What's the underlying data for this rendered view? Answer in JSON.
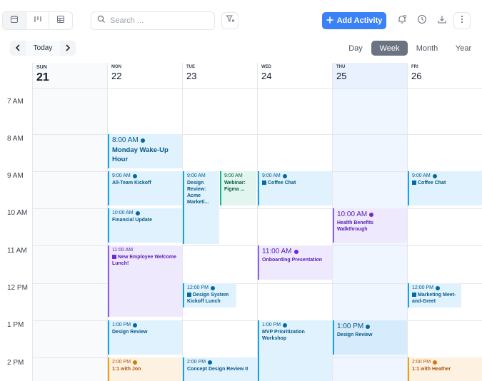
{
  "toolbar": {
    "search_placeholder": "Search ...",
    "add_activity_label": "Add Activity",
    "today_label": "Today"
  },
  "views": [
    {
      "label": "Day",
      "active": false
    },
    {
      "label": "Week",
      "active": true
    },
    {
      "label": "Month",
      "active": false
    },
    {
      "label": "Year",
      "active": false
    }
  ],
  "days": [
    {
      "name": "SUN",
      "date": "21"
    },
    {
      "name": "MON",
      "date": "22"
    },
    {
      "name": "TUE",
      "date": "23"
    },
    {
      "name": "WED",
      "date": "24"
    },
    {
      "name": "THU",
      "date": "25"
    },
    {
      "name": "FRI",
      "date": "26"
    }
  ],
  "hours": [
    "7 AM",
    "8 AM",
    "9 AM",
    "10 AM",
    "11 AM",
    "12 PM",
    "1 PM",
    "2 PM"
  ],
  "events": {
    "mon_wakeup": {
      "time": "8:00 AM",
      "title": "Monday Wake-Up Hour"
    },
    "mon_kickoff": {
      "time": "9:00 AM",
      "title": "All-Team Kickoff"
    },
    "mon_financial": {
      "time": "10:00 AM",
      "title": "Financial Update"
    },
    "mon_lunch": {
      "time": "11:00 AM",
      "title": "New Employee Welcome Lunch!"
    },
    "mon_design_review": {
      "time": "1:00 PM",
      "title": "Design Review"
    },
    "mon_1on1": {
      "time": "2:00 PM",
      "title": "1:1 with Jon"
    },
    "tue_design_review": {
      "time": "9:00 AM",
      "title": "Design Review: Acme Marketi..."
    },
    "tue_webinar": {
      "time": "9:00 AM",
      "title": "Webinar: Figma ..."
    },
    "tue_design_system": {
      "time": "12:00 PM",
      "title": "Design System Kickoff Lunch"
    },
    "tue_concept": {
      "time": "2:00 PM",
      "title": "Concept Design Review II"
    },
    "wed_coffee": {
      "time": "9:00 AM",
      "title": "Coffee Chat"
    },
    "wed_onboarding": {
      "time": "11:00 AM",
      "title": "Onboarding Presentation"
    },
    "wed_mvp": {
      "time": "1:00 PM",
      "title": "MVP Prioritization Workshop"
    },
    "thu_health": {
      "time": "10:00 AM",
      "title": "Health Benefits Walkthrough"
    },
    "thu_design_review": {
      "time": "1:00 PM",
      "title": "Design Review"
    },
    "fri_coffee": {
      "time": "9:00 AM",
      "title": "Coffee Chat"
    },
    "fri_marketing": {
      "time": "12:00 PM",
      "title": "Marketing Meet-and-Greet"
    },
    "fri_1on1": {
      "time": "2:00 PM",
      "title": "1:1 with Heather"
    }
  }
}
